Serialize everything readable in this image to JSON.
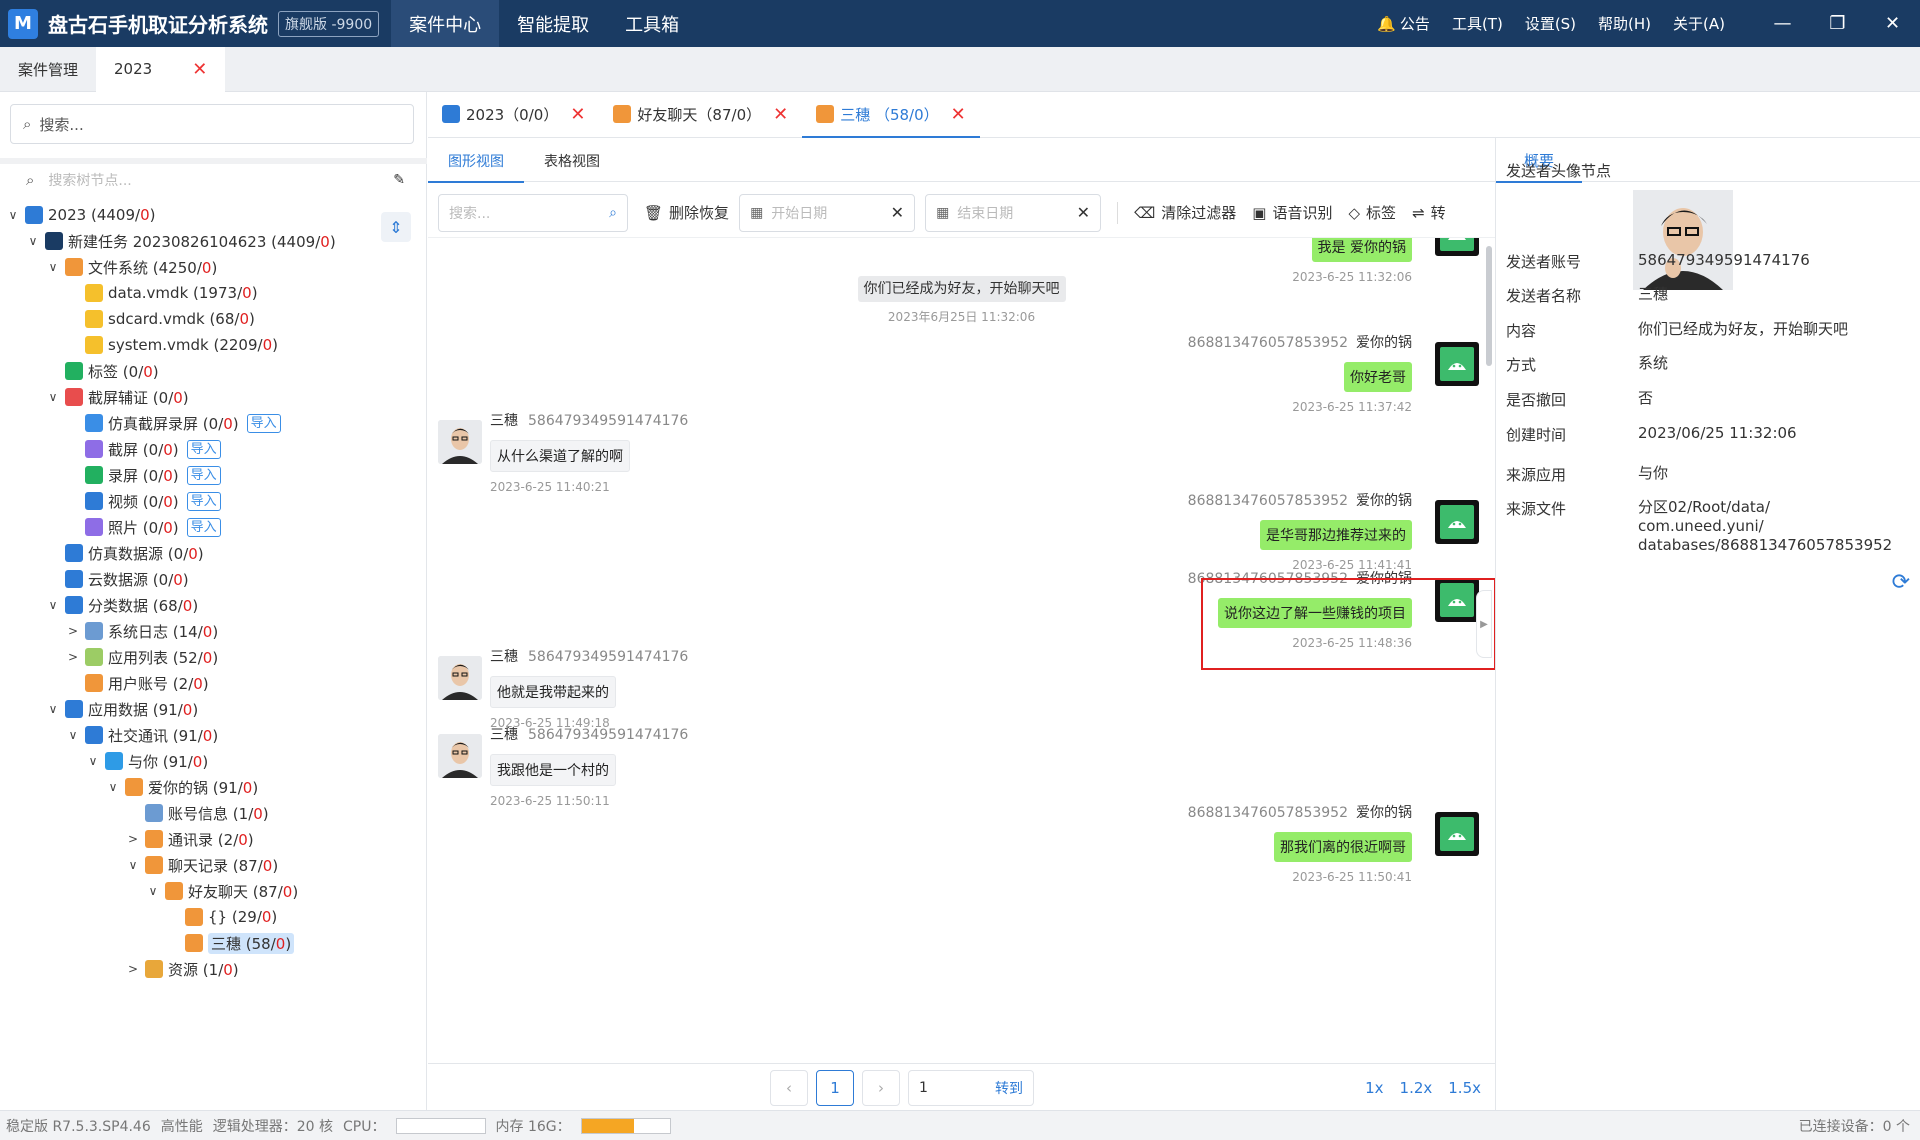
{
  "titlebar": {
    "logo": "M",
    "app_title": "盘古石手机取证分析系统",
    "edition": "旗舰版 -9900",
    "menu": [
      "案件中心",
      "智能提取",
      "工具箱"
    ],
    "right_menu": [
      "公告",
      "工具(T)",
      "设置(S)",
      "帮助(H)",
      "关于(A)"
    ],
    "window_controls": [
      "—",
      "❐",
      "✕"
    ]
  },
  "doc_tabs": [
    {
      "label": "案件管理",
      "active": false
    },
    {
      "label": "2023",
      "active": true,
      "close": "✕"
    }
  ],
  "left_panel": {
    "search_placeholder": "搜索...",
    "tree_search_placeholder": "搜索树节点...",
    "import_label": "导入",
    "nodes": [
      {
        "level": 0,
        "arrow": "∨",
        "icon": "case-icon",
        "color": "#2e7bd6",
        "name": "2023",
        "count": "4409",
        "sub": "0"
      },
      {
        "level": 1,
        "arrow": "∨",
        "icon": "phone-icon",
        "color": "#1a3b63",
        "name": "新建任务 20230826104623",
        "count": "4409",
        "sub": "0"
      },
      {
        "level": 2,
        "arrow": "∨",
        "icon": "filesystem-icon",
        "color": "#f0963a",
        "name": "文件系统",
        "count": "4250",
        "sub": "0"
      },
      {
        "level": 3,
        "arrow": "",
        "icon": "folder-icon",
        "color": "#f5c02c",
        "name": "data.vmdk",
        "count": "1973",
        "sub": "0"
      },
      {
        "level": 3,
        "arrow": "",
        "icon": "folder-icon",
        "color": "#f5c02c",
        "name": "sdcard.vmdk",
        "count": "68",
        "sub": "0"
      },
      {
        "level": 3,
        "arrow": "",
        "icon": "folder-icon",
        "color": "#f5c02c",
        "name": "system.vmdk",
        "count": "2209",
        "sub": "0"
      },
      {
        "level": 2,
        "arrow": "",
        "icon": "tag-icon",
        "color": "#22b060",
        "name": "标签",
        "count": "0",
        "sub": "0"
      },
      {
        "level": 2,
        "arrow": "∨",
        "icon": "screenshot-evidence-icon",
        "color": "#e84d4d",
        "name": "截屏辅证",
        "count": "0",
        "sub": "0"
      },
      {
        "level": 3,
        "arrow": "",
        "icon": "sim-record-icon",
        "color": "#3a8ee6",
        "name": "仿真截屏录屏",
        "count": "0",
        "sub": "0",
        "import": true
      },
      {
        "level": 3,
        "arrow": "",
        "icon": "screenshot-icon",
        "color": "#8e6de6",
        "name": "截屏",
        "count": "0",
        "sub": "0",
        "import": true
      },
      {
        "level": 3,
        "arrow": "",
        "icon": "record-icon",
        "color": "#22b060",
        "name": "录屏",
        "count": "0",
        "sub": "0",
        "import": true
      },
      {
        "level": 3,
        "arrow": "",
        "icon": "video-icon",
        "color": "#2e7bd6",
        "name": "视频",
        "count": "0",
        "sub": "0",
        "import": true
      },
      {
        "level": 3,
        "arrow": "",
        "icon": "photo-icon",
        "color": "#8e6de6",
        "name": "照片",
        "count": "0",
        "sub": "0",
        "import": true
      },
      {
        "level": 2,
        "arrow": "",
        "icon": "sim-data-icon",
        "color": "#2e7bd6",
        "name": "仿真数据源",
        "count": "0",
        "sub": "0"
      },
      {
        "level": 2,
        "arrow": "",
        "icon": "cloud-icon",
        "color": "#2e7bd6",
        "name": "云数据源",
        "count": "0",
        "sub": "0"
      },
      {
        "level": 2,
        "arrow": "∨",
        "icon": "category-icon",
        "color": "#2e7bd6",
        "name": "分类数据",
        "count": "68",
        "sub": "0"
      },
      {
        "level": 3,
        "arrow": ">",
        "icon": "syslog-icon",
        "color": "#6c9bd2",
        "name": "系统日志",
        "count": "14",
        "sub": "0"
      },
      {
        "level": 3,
        "arrow": ">",
        "icon": "applist-icon",
        "color": "#9ccc65",
        "name": "应用列表",
        "count": "52",
        "sub": "0"
      },
      {
        "level": 3,
        "arrow": "",
        "icon": "user-account-icon",
        "color": "#f0963a",
        "name": "用户账号",
        "count": "2",
        "sub": "0"
      },
      {
        "level": 2,
        "arrow": "∨",
        "icon": "app-data-icon",
        "color": "#2e7bd6",
        "name": "应用数据",
        "count": "91",
        "sub": "0"
      },
      {
        "level": 3,
        "arrow": "∨",
        "icon": "social-icon",
        "color": "#2e7bd6",
        "name": "社交通讯",
        "count": "91",
        "sub": "0"
      },
      {
        "level": 4,
        "arrow": "∨",
        "icon": "yuni-icon",
        "color": "#2e9be6",
        "name": "与你",
        "count": "91",
        "sub": "0"
      },
      {
        "level": 5,
        "arrow": "∨",
        "icon": "user-icon",
        "color": "#f0963a",
        "name": "爱你的锅",
        "count": "91",
        "sub": "0"
      },
      {
        "level": 6,
        "arrow": "",
        "icon": "account-info-icon",
        "color": "#6c9bd2",
        "name": "账号信息",
        "count": "1",
        "sub": "0"
      },
      {
        "level": 6,
        "arrow": ">",
        "icon": "contacts-icon",
        "color": "#f0963a",
        "name": "通讯录",
        "count": "2",
        "sub": "0"
      },
      {
        "level": 6,
        "arrow": "∨",
        "icon": "chat-icon",
        "color": "#f0963a",
        "name": "聊天记录",
        "count": "87",
        "sub": "0"
      },
      {
        "level": 7,
        "arrow": "∨",
        "icon": "chat-icon",
        "color": "#f0963a",
        "name": "好友聊天",
        "count": "87",
        "sub": "0"
      },
      {
        "level": 8,
        "arrow": "",
        "icon": "chat-icon",
        "color": "#f0963a",
        "name": "{}",
        "count": "29",
        "sub": "0"
      },
      {
        "level": 8,
        "arrow": "",
        "icon": "chat-icon",
        "color": "#f0963a",
        "name": "三穗",
        "count": "58",
        "sub": "0",
        "selected": true
      },
      {
        "level": 6,
        "arrow": ">",
        "icon": "resource-icon",
        "color": "#e8a73a",
        "name": "资源",
        "count": "1",
        "sub": "0"
      }
    ]
  },
  "mid_tabs": [
    {
      "label": "2023（0/0）",
      "icon": "case-icon",
      "color": "#2e7bd6",
      "active": false
    },
    {
      "label": "好友聊天（87/0）",
      "icon": "chat-icon",
      "color": "#f0963a",
      "active": false
    },
    {
      "label": "三穗 （58/0）",
      "icon": "chat-icon",
      "color": "#f0963a",
      "active": true
    }
  ],
  "view_tabs": [
    "图形视图",
    "表格视图"
  ],
  "toolbar": {
    "search_placeholder": "搜索...",
    "delete_restore": "删除恢复",
    "start_date": "开始日期",
    "end_date": "结束日期",
    "clear_filter": "清除过滤器",
    "voice": "语音识别",
    "tag": "标签",
    "convert": "转"
  },
  "messages": [
    {
      "side": "right",
      "account": "868813476057853952",
      "name": "爱你的锅",
      "text": "我是 爱你的锅",
      "time": "2023-6-25 11:32:06"
    },
    {
      "side": "system",
      "text": "你们已经成为好友，开始聊天吧",
      "time": "2023年6月25日 11:32:06"
    },
    {
      "side": "right",
      "account": "868813476057853952",
      "name": "爱你的锅",
      "text": "你好老哥",
      "time": "2023-6-25 11:37:42"
    },
    {
      "side": "left",
      "account": "586479349591474176",
      "name": "三穗",
      "text": "从什么渠道了解的啊",
      "time": "2023-6-25 11:40:21"
    },
    {
      "side": "right",
      "account": "868813476057853952",
      "name": "爱你的锅",
      "text": "是华哥那边推荐过来的",
      "time": "2023-6-25 11:41:41"
    },
    {
      "side": "right",
      "account": "868813476057853952",
      "name": "爱你的锅",
      "text": "说你这边了解一些赚钱的项目",
      "time": "2023-6-25 11:48:36"
    },
    {
      "side": "left",
      "account": "586479349591474176",
      "name": "三穗",
      "text": "他就是我带起来的",
      "time": "2023-6-25 11:49:18"
    },
    {
      "side": "left",
      "account": "586479349591474176",
      "name": "三穗",
      "text": "我跟他是一个村的",
      "time": "2023-6-25 11:50:11"
    },
    {
      "side": "right",
      "account": "868813476057853952",
      "name": "爱你的锅",
      "text": "那我们离的很近啊哥",
      "time": "2023-6-25 11:50:41"
    }
  ],
  "pager": {
    "current": "1",
    "jump_value": "1",
    "jump_label": "转到",
    "zooms": [
      "1x",
      "1.2x",
      "1.5x"
    ]
  },
  "right_panel": {
    "tab": "概要",
    "props": [
      {
        "label": "发送者头像节点",
        "value": ""
      },
      {
        "label": "发送者账号",
        "value": "586479349591474176"
      },
      {
        "label": "发送者名称",
        "value": "三穗"
      },
      {
        "label": "内容",
        "value": "你们已经成为好友，开始聊天吧"
      },
      {
        "label": "方式",
        "value": "系统"
      },
      {
        "label": "是否撤回",
        "value": "否"
      },
      {
        "label": "创建时间",
        "value": "2023/06/25 11:32:06"
      },
      {
        "label": "来源应用",
        "value": "与你"
      },
      {
        "label": "来源文件",
        "value": "分区02/Root/data/ com.uneed.yuni/ databases/868813476057853952"
      }
    ]
  },
  "statusbar": {
    "version": "稳定版 R7.5.3.SP4.46",
    "perf": "高性能",
    "cpu_cores": "逻辑处理器：20 核",
    "cpu_label": "CPU：",
    "cpu_usage": 0.0,
    "mem_label": "内存 16G：",
    "mem_usage": 0.6,
    "devices": "已连接设备：0 个"
  },
  "colors": {
    "titlebar": "#1a3b63",
    "accent": "#2e7bd6",
    "bubble_self": "#95ec69",
    "highlight": "#e02020",
    "count_red": "#e02020"
  }
}
